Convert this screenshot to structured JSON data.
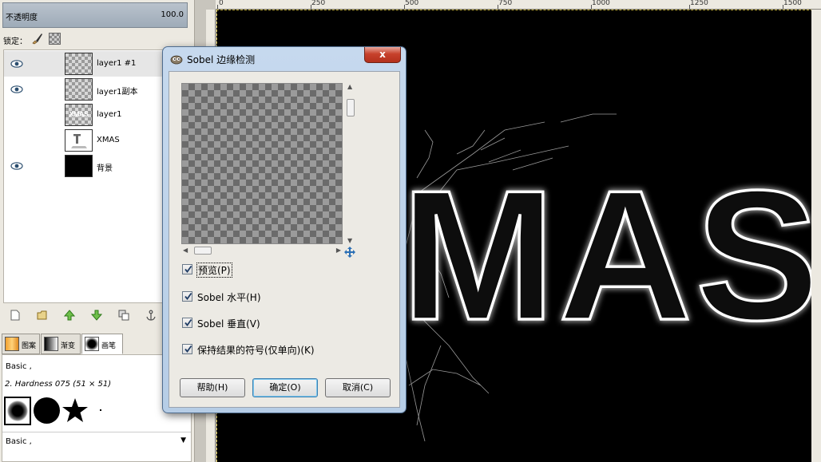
{
  "layers_panel": {
    "opacity_label": "不透明度",
    "opacity_value": "100.0",
    "lock_label": "锁定：",
    "layers": [
      {
        "name": "layer1 #1",
        "visible": true,
        "thumb": "checker"
      },
      {
        "name": "layer1副本",
        "visible": true,
        "thumb": "checker"
      },
      {
        "name": "layer1",
        "visible": false,
        "thumb": "xmas",
        "thumb_text": "XMAS"
      },
      {
        "name": "XMAS",
        "visible": false,
        "thumb": "white"
      },
      {
        "name": "背景",
        "visible": true,
        "thumb": "dark"
      }
    ]
  },
  "brush_tabs": [
    {
      "label": "图案"
    },
    {
      "label": "渐变"
    },
    {
      "label": "画笔"
    }
  ],
  "brushes": {
    "set_name": "Basic ,",
    "current": "2. Hardness 075 (51 × 51)",
    "set_name_2": "Basic ,"
  },
  "ruler": {
    "ticks": [
      "0",
      "250",
      "500",
      "750",
      "1000",
      "1250",
      "1500"
    ]
  },
  "canvas": {
    "text": "MAS"
  },
  "dialog": {
    "title": "Sobel 边缘检测",
    "close_glyph": "x",
    "checkboxes": [
      {
        "label": "预览(P)",
        "checked": true
      },
      {
        "label": "Sobel 水平(H)",
        "checked": true
      },
      {
        "label": "Sobel 垂直(V)",
        "checked": true
      },
      {
        "label": "保持结果的符号(仅单向)(K)",
        "checked": true
      }
    ],
    "buttons": {
      "help": "帮助(H)",
      "ok": "确定(O)",
      "cancel": "取消(C)"
    }
  }
}
